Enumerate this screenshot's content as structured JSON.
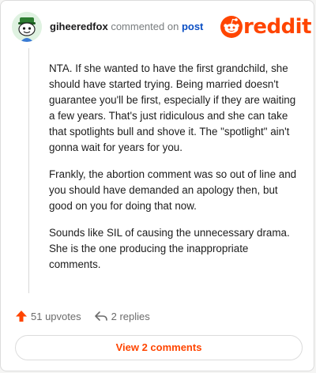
{
  "header": {
    "username": "giheeredfox",
    "action": "commented on",
    "link": "post"
  },
  "logo": {
    "word": "reddit",
    "color": "#ff4500",
    "icon": "reddit-snoo-icon"
  },
  "comment": {
    "paragraphs": [
      "NTA. If she wanted to have the first grandchild, she should have started trying. Being married doesn't guarantee you'll be first, especially if they are waiting a few years. That's just ridiculous and she can take that spotlights bull and shove it. The \"spotlight\" ain't gonna wait for years for you.",
      "Frankly, the abortion comment was so out of line and you should have demanded an apology then, but good on you for doing that now.",
      "Sounds like SIL of causing the unnecessary drama. She is the one producing the inappropriate comments."
    ]
  },
  "footer": {
    "upvotes": "51 upvotes",
    "replies": "2 replies",
    "upvote_icon": "upvote-arrow-icon",
    "reply_icon": "reply-arrow-icon"
  },
  "button": {
    "label": "View 2 comments"
  },
  "colors": {
    "accent": "#ff4500",
    "link": "#0b4fc4",
    "text": "#1c1c1c",
    "muted": "#6b6b6b"
  }
}
